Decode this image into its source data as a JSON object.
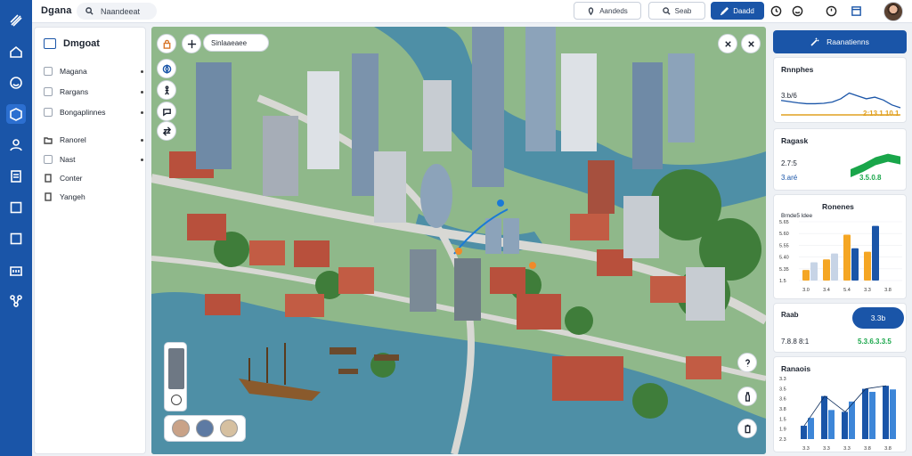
{
  "app": {
    "name": "Dgana"
  },
  "topbar": {
    "search_label": "Naandeeat",
    "btn1_label": "Aandeds",
    "btn2_label": "Seab",
    "btn3_label": "Daadd"
  },
  "side": {
    "title": "Dmgoat",
    "group1": [
      {
        "label": "Magana"
      },
      {
        "label": "Rargans"
      },
      {
        "label": "Bongaplinnes"
      }
    ],
    "group2": [
      {
        "label": "Ranorel"
      },
      {
        "label": "Nast"
      },
      {
        "label": "Conter"
      },
      {
        "label": "Yangeh"
      }
    ]
  },
  "map": {
    "search_label": "Sinlaaeaee"
  },
  "right": {
    "action_label": "Raanatienns",
    "card1": {
      "title": "Rnnphes",
      "value": "3.b/6",
      "value2": "2:13.1.10.1"
    },
    "card2": {
      "title": "Ragask",
      "line1": "2.7:5",
      "line2": "3.aré",
      "value": "3.5.0.8"
    },
    "card3": {
      "title": "Ronenes",
      "subtitle": "Brnde5 ldee",
      "yticks": [
        "5.65",
        "5.60",
        "5.55",
        "5.40",
        "5.35",
        "1.5"
      ],
      "xticks": [
        "3.0",
        "3.4",
        "5.4",
        "3.3",
        "3.8"
      ]
    },
    "card4": {
      "line1": "Raab",
      "line2": "7.8.8  8:1",
      "pill": "3.3b",
      "value": "5.3.6.3.3.5"
    },
    "card5": {
      "title": "Ranaois",
      "yticks": [
        "3.3",
        "3.5",
        "3.6",
        "3.8",
        "1.5",
        "1.9",
        "2.3"
      ],
      "xticks": [
        "3.3",
        "3.3",
        "3.3",
        "3.8",
        "3.8"
      ]
    }
  },
  "chart_data": [
    {
      "type": "line",
      "title": "Rnnphes",
      "values": [
        0.44,
        0.41,
        0.38,
        0.36,
        0.36,
        0.37,
        0.4,
        0.48,
        0.62,
        0.55,
        0.48,
        0.52,
        0.45,
        0.33,
        0.26
      ]
    },
    {
      "type": "area",
      "title": "Ragask",
      "values": [
        0.1,
        0.3,
        0.55,
        0.68,
        0.58
      ]
    },
    {
      "type": "bar",
      "title": "Ronenes",
      "series": [
        {
          "values": [
            0.18,
            0.36,
            0.78,
            0.49
          ]
        },
        {
          "values": [
            0.31,
            0.46,
            0.55,
            0.93
          ]
        }
      ]
    },
    {
      "type": "bar",
      "title": "Ranaois",
      "series": [
        {
          "values": [
            0.22,
            0.71,
            0.45,
            0.83,
            0.88
          ]
        },
        {
          "values": [
            0.35,
            0.48,
            0.62,
            0.78,
            0.82
          ]
        }
      ]
    }
  ],
  "colors": {
    "primary": "#1a55a8",
    "accent_orange": "#f5a623",
    "green": "#19a64a",
    "water": "#4e8fa6"
  }
}
